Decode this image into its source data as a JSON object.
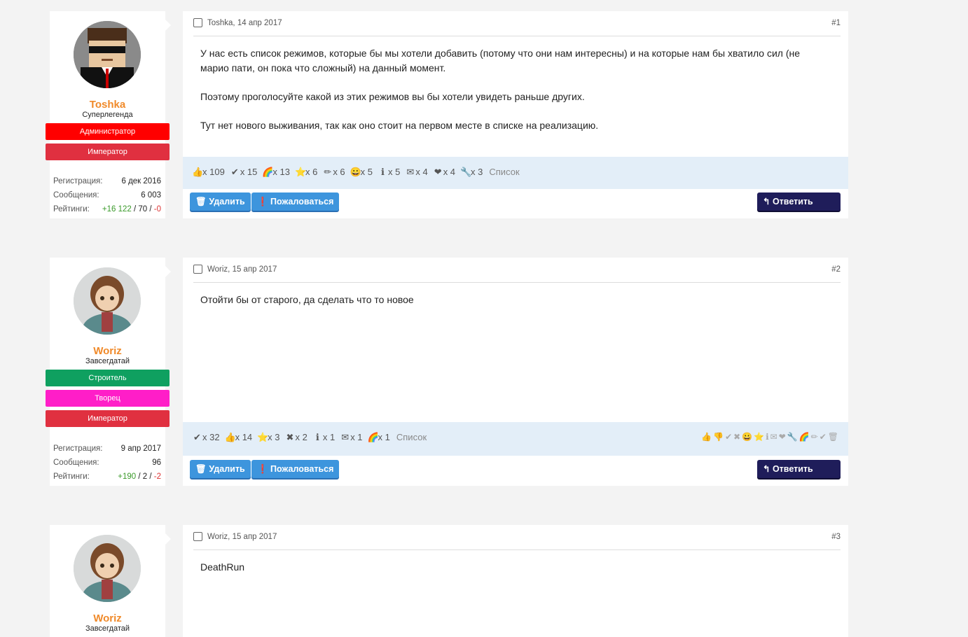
{
  "posts": [
    {
      "user": {
        "name": "Toshka",
        "title": "Суперлегенда",
        "badges": [
          {
            "label": "Администратор",
            "color": "#ff0000"
          },
          {
            "label": "Император",
            "color": "#e03040"
          }
        ],
        "stats": {
          "reg_label": "Регистрация:",
          "reg_value": "6 дек 2016",
          "msg_label": "Сообщения:",
          "msg_value": "6 003",
          "rating_label": "Рейтинги:",
          "rating_pos": "+16 122",
          "rating_neutral": "70",
          "rating_neg": "-0"
        }
      },
      "author_line": "Toshka, 14 апр 2017",
      "number": "#1",
      "body": [
        "У нас есть список режимов, которые бы мы хотели добавить (потому что они нам интересны) и на которые нам бы хватило сил (не марио пати, он пока что сложный) на данный момент.",
        "Поэтому проголосуйте какой из этих режимов вы бы хотели увидеть раньше других.",
        "Тут нет нового выживания, так как оно стоит на первом месте в списке на реализацию."
      ],
      "likes": [
        {
          "icon": "👍",
          "count": "x 109"
        },
        {
          "icon": "✔",
          "count": "x 15"
        },
        {
          "icon": "🌈",
          "count": "x 13"
        },
        {
          "icon": "⭐",
          "count": "x 6"
        },
        {
          "icon": "✏",
          "count": "x 6"
        },
        {
          "icon": "😀",
          "count": "x 5"
        },
        {
          "icon": "ℹ",
          "count": "x 5"
        },
        {
          "icon": "✉",
          "count": "x 4"
        },
        {
          "icon": "❤",
          "count": "x 4"
        },
        {
          "icon": "🔧",
          "count": "x 3"
        }
      ],
      "likes_list_label": "Список",
      "delete_label": "Удалить",
      "report_label": "Пожаловаться",
      "reply_label": "Ответить"
    },
    {
      "user": {
        "name": "Woriz",
        "title": "Завсегдатай",
        "badges": [
          {
            "label": "Строитель",
            "color": "#0fa060"
          },
          {
            "label": "Творец",
            "color": "#ff1ec8"
          },
          {
            "label": "Император",
            "color": "#e03040"
          }
        ],
        "stats": {
          "reg_label": "Регистрация:",
          "reg_value": "9 апр 2017",
          "msg_label": "Сообщения:",
          "msg_value": "96",
          "rating_label": "Рейтинги:",
          "rating_pos": "+190",
          "rating_neutral": "2",
          "rating_neg": "-2"
        }
      },
      "author_line": "Woriz, 15 апр 2017",
      "number": "#2",
      "body": [
        "Отойти бы от старого, да сделать что то новое"
      ],
      "likes": [
        {
          "icon": "✔",
          "count": "x 32"
        },
        {
          "icon": "👍",
          "count": "x 14"
        },
        {
          "icon": "⭐",
          "count": "x 3"
        },
        {
          "icon": "✖",
          "count": "x 2"
        },
        {
          "icon": "ℹ",
          "count": "x 1"
        },
        {
          "icon": "✉",
          "count": "x 1"
        },
        {
          "icon": "🌈",
          "count": "x 1"
        }
      ],
      "likes_list_label": "Список",
      "reaction_strip": "👍👎✔✖😀⭐ℹ✉❤🔧🌈✏✔🗑",
      "delete_label": "Удалить",
      "report_label": "Пожаловаться",
      "reply_label": "Ответить"
    },
    {
      "user": {
        "name": "Woriz",
        "title": "Завсегдатай"
      },
      "author_line": "Woriz, 15 апр 2017",
      "number": "#3",
      "body": [
        "DeathRun"
      ]
    }
  ],
  "colors": {
    "username": "#f08a2a",
    "button_blue": "#3d95dd",
    "button_reply": "#1f1d5a",
    "likes_bg": "#e3eef8"
  }
}
